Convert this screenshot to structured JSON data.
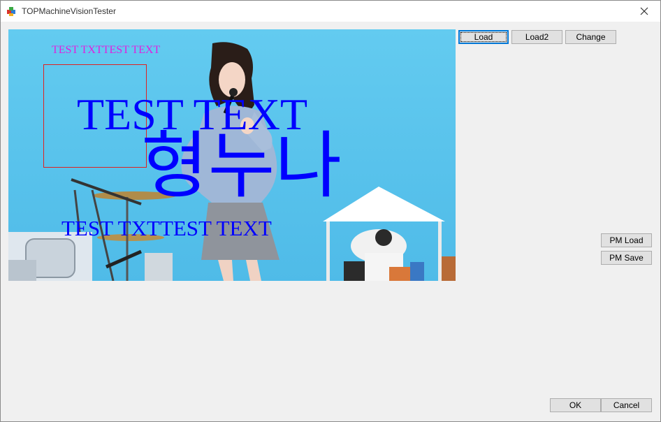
{
  "window": {
    "title": "TOPMachineVisionTester"
  },
  "viewer": {
    "overlay_small": "TEST TXTTEST TEXT",
    "overlay_large": "TEST TEXT",
    "overlay_korean": "형누나",
    "overlay_bottom": "TEST TXTTEST TEXT"
  },
  "toolbar": {
    "load_label": "Load",
    "load2_label": "Load2",
    "change_label": "Change"
  },
  "pm": {
    "load_label": "PM Load",
    "save_label": "PM Save"
  },
  "footer": {
    "ok_label": "OK",
    "cancel_label": "Cancel"
  },
  "colors": {
    "overlay_blue": "#0000ff",
    "overlay_magenta": "#e020e0",
    "roi_red": "#e02020",
    "sky": "#5cc6ee"
  }
}
